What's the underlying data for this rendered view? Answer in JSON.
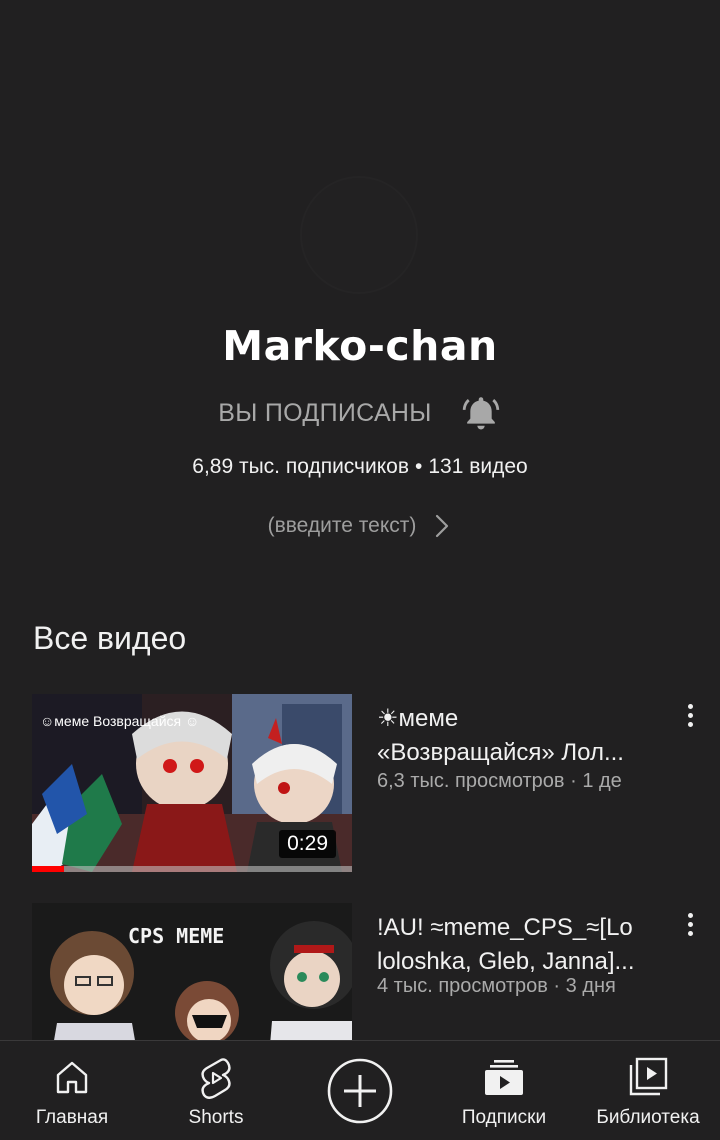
{
  "channel": {
    "name": "Marko-chan",
    "subscribed_label": "ВЫ ПОДПИСАНЫ",
    "subscribers": "6,89 тыс. подписчиков",
    "separator": "•",
    "video_count": "131 видео",
    "about": "(введите текст)"
  },
  "section": {
    "title": "Все видео"
  },
  "videos": [
    {
      "title_line1": "☀меме",
      "title_line2": "«Возвращайся» Лол...",
      "meta": "6,3 тыс. просмотров · 1 де",
      "duration": "0:29",
      "watch_progress": 0.1,
      "thumb_caption": "☺меме  Возвращайся ☺"
    },
    {
      "title_line1": "!AU! ≈meme_CPS_≈[Lo",
      "title_line2": "loloshka, Gleb, Janna]...",
      "meta": "4 тыс. просмотров · 3 дня",
      "thumb_caption": "CPS MEME"
    }
  ],
  "nav": {
    "home": "Главная",
    "shorts": "Shorts",
    "subscriptions": "Подписки",
    "library": "Библиотека"
  },
  "icons": {
    "bell": "bell-ring-icon",
    "chevron": "chevron-right-icon",
    "more": "more-vert-icon",
    "home": "home-icon",
    "shorts": "shorts-icon",
    "create": "create-plus-icon",
    "subscriptions": "subscriptions-icon",
    "library": "library-icon"
  },
  "colors": {
    "background": "#212021",
    "progress": "#ff0000",
    "muted_text": "#aaaaaa"
  }
}
